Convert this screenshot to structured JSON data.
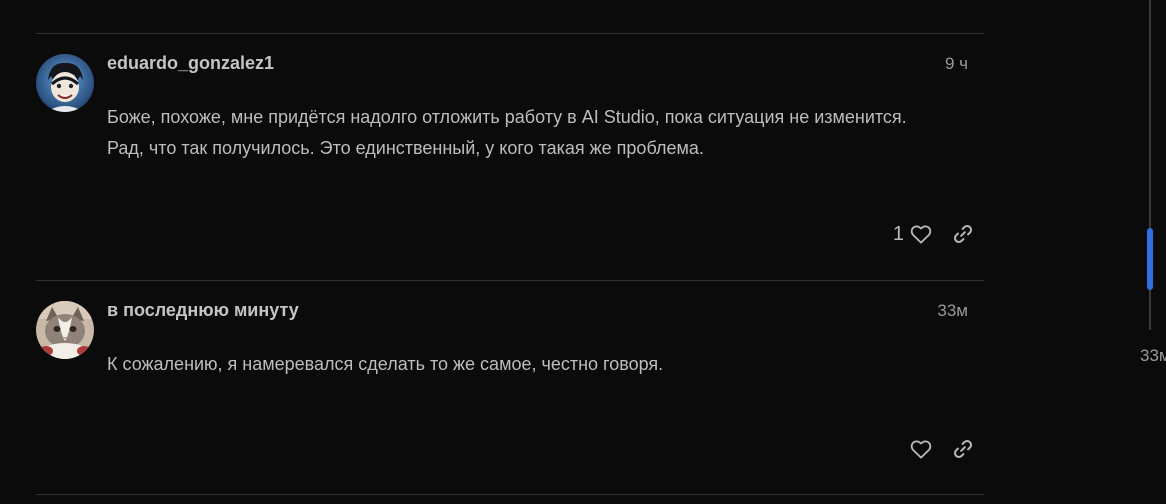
{
  "posts": [
    {
      "username": "eduardo_gonzalez1",
      "time": "9 ч",
      "body": "Боже, похоже, мне придётся надолго отложить работу в AI Studio, пока ситуация не изменится. Рад, что так получилось. Это единственный, у кого такая же проблема.",
      "like_count": "1",
      "avatar_icon": "anime-character-avatar",
      "like_icon": "heart-icon",
      "link_icon": "link-icon"
    },
    {
      "username": "в последнюю минуту",
      "time": "33м",
      "body": "К сожалению, я намеревался сделать то же самое, честно говоря.",
      "like_count": "",
      "avatar_icon": "cat-avatar",
      "like_icon": "heart-icon",
      "link_icon": "link-icon"
    }
  ],
  "timeline": {
    "label": "33м"
  },
  "colors": {
    "background": "#0c0b0c",
    "text": "#bdbdbd",
    "muted": "#9a9a9a",
    "accent": "#2f6fe0"
  }
}
